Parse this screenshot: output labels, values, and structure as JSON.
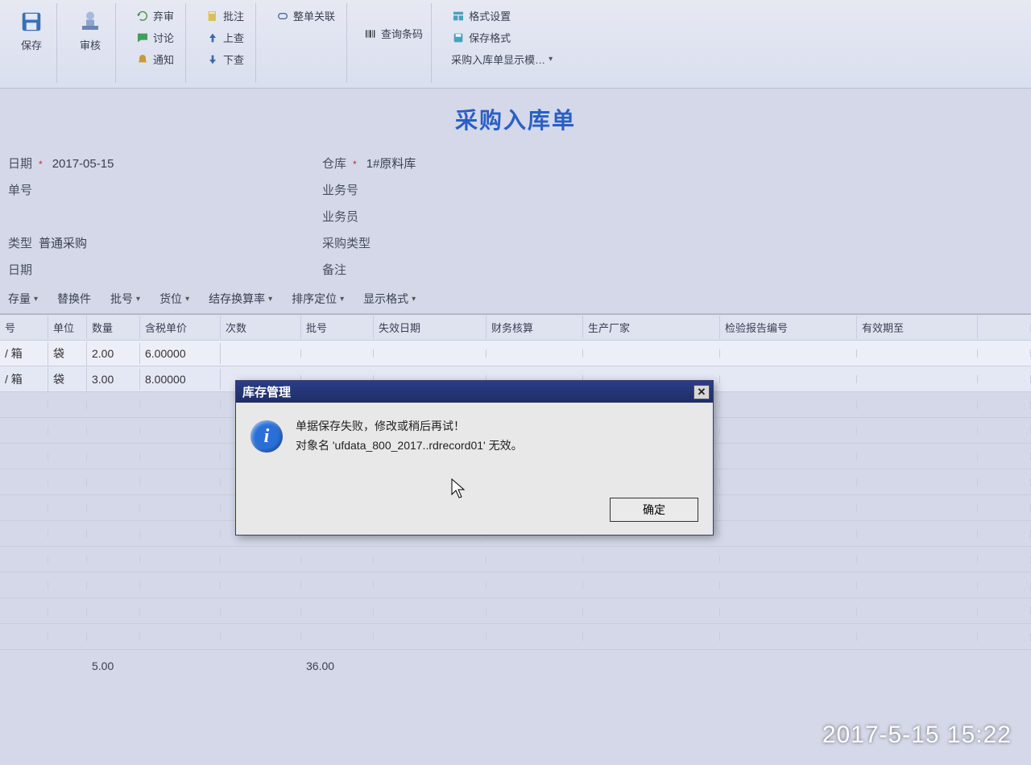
{
  "ribbon": {
    "save": "保存",
    "review": "审核",
    "unreview": "弃审",
    "annotate": "批注",
    "discuss": "讨论",
    "notify": "通知",
    "up_check": "上查",
    "down_check": "下查",
    "full_link": "整单关联",
    "barcode_query": "查询条码",
    "format_set": "格式设置",
    "save_format": "保存格式",
    "display_template": "采购入库单显示模…"
  },
  "doc": {
    "title": "采购入库单"
  },
  "header": {
    "date_label": "日期",
    "date_value": "2017-05-15",
    "warehouse_label": "仓库",
    "warehouse_value": "1#原料库",
    "docno_label": "单号",
    "bizno_label": "业务号",
    "bizperson_label": "业务员",
    "type_label": "类型",
    "type_value": "普通采购",
    "purchase_type_label": "采购类型",
    "date2_label": "日期",
    "remark_label": "备注"
  },
  "filter": {
    "stock_qty": "存量",
    "replace": "替换件",
    "batch": "批号",
    "location": "货位",
    "settle_rate": "结存换算率",
    "sort_locate": "排序定位",
    "display_fmt": "显示格式"
  },
  "grid": {
    "headers": {
      "seq": "号",
      "unit": "单位",
      "qty": "数量",
      "tax_price": "含税单价",
      "aux": "次数",
      "batch": "批号",
      "expire": "失效日期",
      "finance": "财务核算",
      "vendor": "生产厂家",
      "inspection": "检验报告编号",
      "valid_to": "有效期至"
    },
    "rows": [
      {
        "seq": "/ 箱",
        "unit": "袋",
        "qty": "2.00",
        "tax_price": "6.00000"
      },
      {
        "seq": "/ 箱",
        "unit": "袋",
        "qty": "3.00",
        "tax_price": "8.00000"
      }
    ],
    "totals": {
      "qty": "5.00",
      "amount": "36.00"
    }
  },
  "dialog": {
    "title": "库存管理",
    "line1": "单据保存失败，修改或稍后再试！",
    "line2": "对象名 'ufdata_800_2017..rdrecord01' 无效。",
    "ok": "确定"
  },
  "camera_stamp": "2017-5-15 15:22"
}
